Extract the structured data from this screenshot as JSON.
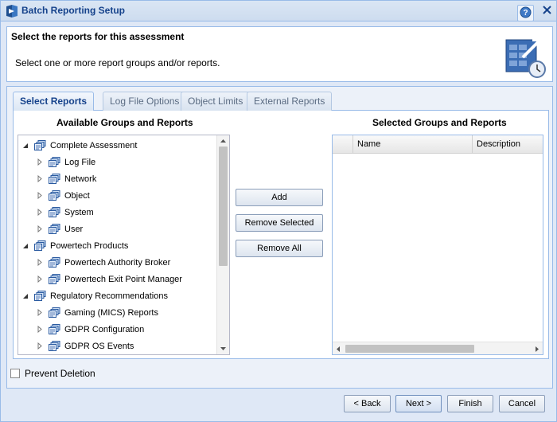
{
  "window": {
    "title": "Batch Reporting Setup"
  },
  "header": {
    "title": "Select the reports for this assessment",
    "subtitle": "Select one or more report groups and/or reports."
  },
  "tabs": [
    {
      "label": "Select Reports",
      "active": true
    },
    {
      "label": "Log File Options",
      "active": false
    },
    {
      "label": "Object Limits",
      "active": false
    },
    {
      "label": "External Reports",
      "active": false
    }
  ],
  "available": {
    "heading": "Available Groups and Reports",
    "tree": [
      {
        "label": "Complete Assessment",
        "level": 0,
        "expanded": true
      },
      {
        "label": "Log File",
        "level": 1,
        "expanded": false
      },
      {
        "label": "Network",
        "level": 1,
        "expanded": false
      },
      {
        "label": "Object",
        "level": 1,
        "expanded": false
      },
      {
        "label": "System",
        "level": 1,
        "expanded": false
      },
      {
        "label": "User",
        "level": 1,
        "expanded": false
      },
      {
        "label": "Powertech Products",
        "level": 0,
        "expanded": true
      },
      {
        "label": "Powertech Authority Broker",
        "level": 1,
        "expanded": false
      },
      {
        "label": "Powertech Exit Point Manager",
        "level": 1,
        "expanded": false
      },
      {
        "label": "Regulatory Recommendations",
        "level": 0,
        "expanded": true
      },
      {
        "label": "Gaming (MICS) Reports",
        "level": 1,
        "expanded": false
      },
      {
        "label": "GDPR Configuration",
        "level": 1,
        "expanded": false
      },
      {
        "label": "GDPR OS Events",
        "level": 1,
        "expanded": false
      }
    ]
  },
  "actions": {
    "add": "Add",
    "remove_selected": "Remove Selected",
    "remove_all": "Remove All"
  },
  "selected": {
    "heading": "Selected Groups and Reports",
    "columns": [
      "",
      "Name",
      "Description"
    ]
  },
  "options": {
    "prevent_deletion": "Prevent Deletion",
    "prevent_deletion_checked": false
  },
  "footer": {
    "back": "< Back",
    "next": "Next >",
    "finish": "Finish",
    "cancel": "Cancel"
  },
  "icons": {
    "app": "batch-report-icon",
    "help": "help-icon",
    "close": "close-icon",
    "header_graphic": "report-wizard-icon",
    "tree_node": "report-group-icon"
  },
  "colors": {
    "window_bg": "#dfe8f6",
    "border": "#99bbe8",
    "title_text": "#15428b",
    "active_tab_text": "#15428b"
  }
}
